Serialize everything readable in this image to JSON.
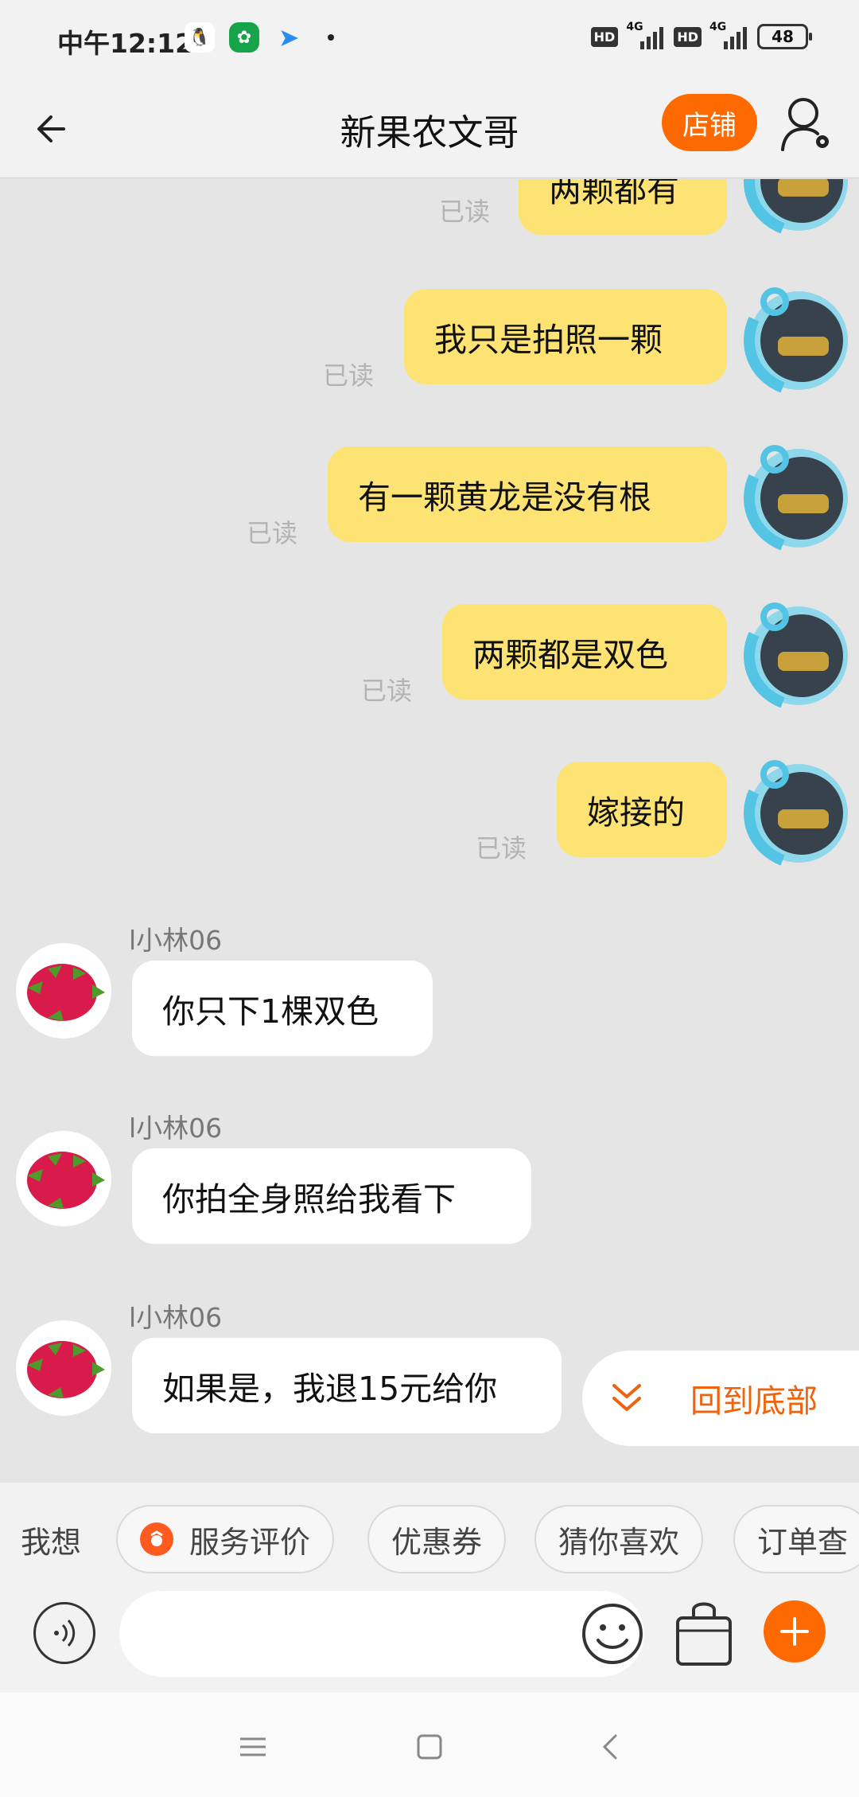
{
  "status_bar": {
    "time": "中午12:12",
    "battery": "48",
    "hd": "HD",
    "net": "4G"
  },
  "header": {
    "title": "新果农文哥",
    "store_label": "店铺"
  },
  "messages_me": [
    {
      "text": "两颗都有",
      "read": "已读"
    },
    {
      "text": "我只是拍照一颗",
      "read": "已读"
    },
    {
      "text": "有一颗黄龙是没有根",
      "read": "已读"
    },
    {
      "text": "两颗都是双色",
      "read": "已读"
    },
    {
      "text": "嫁接的",
      "read": "已读"
    }
  ],
  "messages_them": [
    {
      "nick": "l小林06",
      "text": "你只下1棵双色"
    },
    {
      "nick": "l小林06",
      "text": "你拍全身照给我看下"
    },
    {
      "nick": "l小林06",
      "text": "如果是，我退15元给你"
    }
  ],
  "back_to_bottom": "回到底部",
  "quickbar": {
    "label": "我想",
    "chips": [
      "服务评价",
      "优惠券",
      "猜你喜欢",
      "订单查"
    ]
  },
  "input": {
    "placeholder": ""
  },
  "colors": {
    "accent": "#ff6a00",
    "bubble_me": "#fde274",
    "bubble_them": "#ffffff",
    "background": "#e5e5e5"
  }
}
